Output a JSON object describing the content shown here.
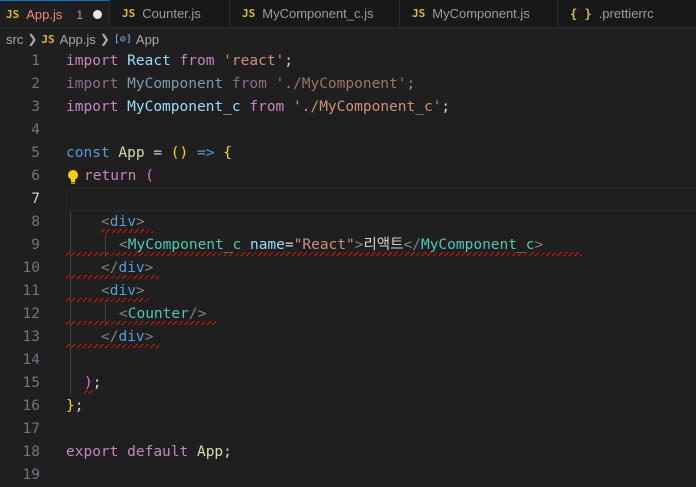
{
  "tabs": [
    {
      "badge": "JS",
      "title": "App.js",
      "errors": "1",
      "dirty": true
    },
    {
      "badge": "JS",
      "title": "Counter.js"
    },
    {
      "badge": "JS",
      "title": "MyComponent_c.js"
    },
    {
      "badge": "JS",
      "title": "MyComponent.js"
    },
    {
      "badge": "{ }",
      "title": ".prettierrc"
    }
  ],
  "breadcrumb": {
    "folder": "src",
    "file_badge": "JS",
    "file": "App.js",
    "symbol_icon": "[⊘]",
    "symbol": "App"
  },
  "editor": {
    "current_line": 7,
    "line_numbers": [
      "1",
      "2",
      "3",
      "4",
      "5",
      "6",
      "7",
      "8",
      "9",
      "10",
      "11",
      "12",
      "13",
      "14",
      "15",
      "16",
      "17",
      "18",
      "19"
    ],
    "lines": {
      "l1": {
        "a": "import",
        "b": "React",
        "c": "from",
        "d": "'react'",
        "e": ";"
      },
      "l2": {
        "a": "import",
        "b": "MyComponent",
        "c": "from",
        "d": "'./MyComponent'",
        "e": ";"
      },
      "l3": {
        "a": "import",
        "b": "MyComponent_c",
        "c": "from",
        "d": "'./MyComponent_c'",
        "e": ";"
      },
      "l5": {
        "a": "const",
        "b": "App",
        "c": " = ",
        "d": "()",
        "e": " => ",
        "f": "{"
      },
      "l6": {
        "a": "return",
        "b": " ("
      },
      "l8": {
        "a": "<",
        "b": "div",
        "c": ">"
      },
      "l9": {
        "a": "<",
        "b": "MyComponent_c",
        "c": " name",
        "d": "=",
        "e": "\"React\"",
        "f": ">",
        "g": "리액트",
        "h": "</",
        "i": "MyComponent_c",
        "j": ">"
      },
      "l10": {
        "a": "</",
        "b": "div",
        "c": ">"
      },
      "l11": {
        "a": "<",
        "b": "div",
        "c": ">"
      },
      "l12": {
        "a": "<",
        "b": "Counter",
        "c": "/>"
      },
      "l13": {
        "a": "</",
        "b": "div",
        "c": ">"
      },
      "l15": {
        "a": ")",
        "b": ";"
      },
      "l16": {
        "a": "}",
        "b": ";"
      },
      "l18": {
        "a": "export",
        "b": "default",
        "c": "App",
        "d": ";"
      }
    }
  },
  "colors": {
    "accent": "#0078d4",
    "error": "#f48771",
    "jsBadge": "#d7ba3d"
  },
  "icons": {
    "lightbulb": "lightbulb-icon",
    "symbol": "symbol-variable-icon"
  }
}
